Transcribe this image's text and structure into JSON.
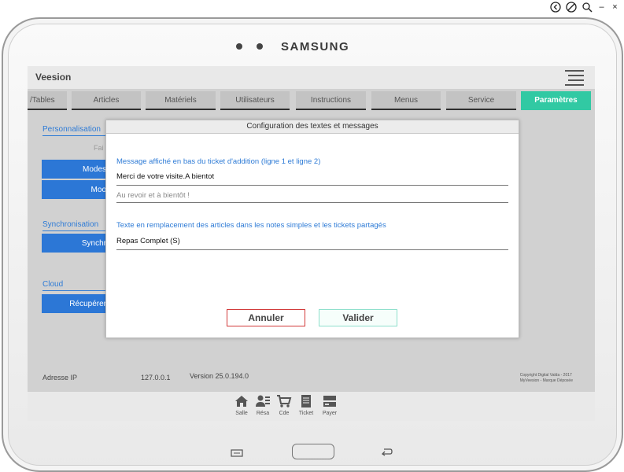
{
  "device": {
    "brand": "SAMSUNG"
  },
  "app": {
    "title": "Veesion"
  },
  "tabs": [
    {
      "label": "/Tables"
    },
    {
      "label": "Articles"
    },
    {
      "label": "Matériels"
    },
    {
      "label": "Utilisateurs"
    },
    {
      "label": "Instructions"
    },
    {
      "label": "Menus"
    },
    {
      "label": "Service"
    },
    {
      "label": "Paramètres",
      "active": true
    }
  ],
  "sidebar": {
    "personnalisation_label": "Personnalisation",
    "faded_text": "Fai",
    "btn1": "Modes",
    "btn2": "Moo",
    "sync_label": "Synchronisation",
    "btn3": "Synchr",
    "cloud_label": "Cloud",
    "btn4": "Récupérer"
  },
  "footer": {
    "ip_label": "Adresse IP",
    "ip_value": "127.0.0.1",
    "version": "Version 25.0.194.0",
    "copyright_line1": "Copyright Digital Valda - 2017",
    "copyright_line2": "MyVeesion - Marque Déposée"
  },
  "bottom_nav": [
    {
      "label": "Salle",
      "icon": "house-icon"
    },
    {
      "label": "Résa",
      "icon": "reservation-icon"
    },
    {
      "label": "Cde",
      "icon": "cart-icon"
    },
    {
      "label": "Ticket",
      "icon": "ticket-icon"
    },
    {
      "label": "Payer",
      "icon": "payment-icon"
    }
  ],
  "modal": {
    "title": "Configuration des textes et messages",
    "field1_label": "Message affiché en bas du ticket d'addition (ligne 1 et ligne 2)",
    "field1_line1": "Merci de votre visite.A bientot",
    "field1_line2_placeholder": "Au revoir et à bientôt !",
    "field2_label": "Texte en remplacement des articles dans les notes simples et les tickets partagés",
    "field2_value": "Repas Complet (S)",
    "cancel_label": "Annuler",
    "ok_label": "Valider"
  },
  "colors": {
    "accent": "#31c9a3",
    "primary_blue": "#2c77d6",
    "cancel_border": "#d23a3a"
  }
}
